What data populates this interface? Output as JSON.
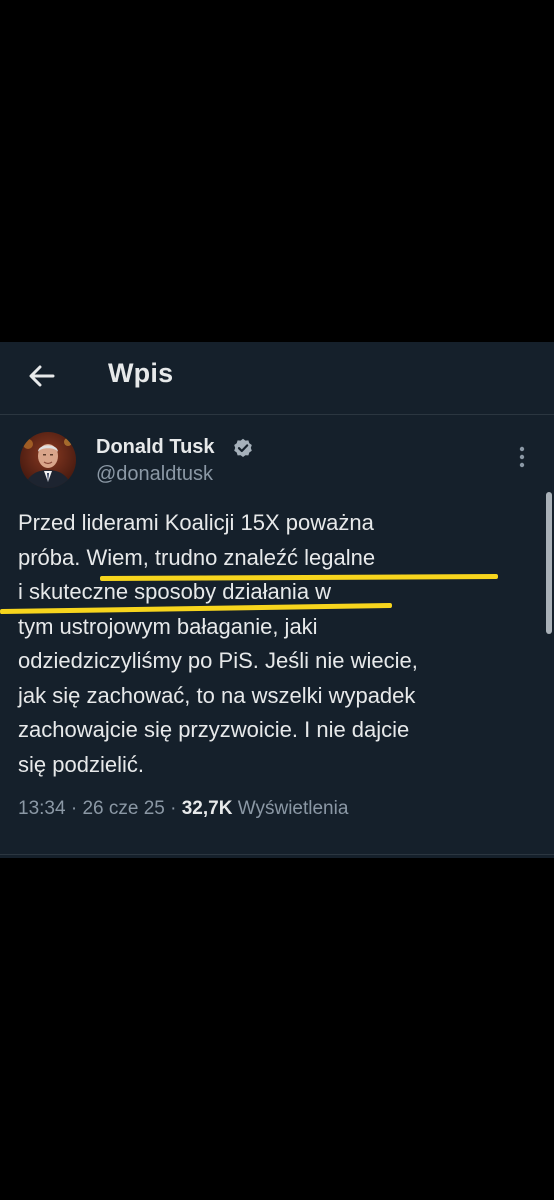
{
  "colors": {
    "background": "#15202b",
    "text_primary": "#e7e9ea",
    "text_secondary": "#8b98a5",
    "highlight": "#f7d51d",
    "verified_badge": "#a5b0ba"
  },
  "header": {
    "back_icon": "arrow-left-icon",
    "title": "Wpis"
  },
  "author": {
    "name": "Donald Tusk",
    "handle": "@donaldtusk",
    "verified_icon": "verified-badge-icon",
    "avatar_icon": "avatar-photo"
  },
  "more_icon": "more-vertical-icon",
  "tweet": {
    "lines": [
      "Przed liderami Koalicji 15X poważna",
      "próba. Wiem, trudno znaleźć legalne",
      "i skuteczne sposoby działania w",
      "tym ustrojowym bałaganie, jaki",
      "odziedziczyliśmy po PiS. Jeśli nie wiecie,",
      "jak się zachować, to na wszelki wypadek",
      "zachowajcie się przyzwoicie. I nie dajcie",
      "się podzielić."
    ]
  },
  "meta": {
    "time": "13:34",
    "separator": " · ",
    "date": "26 cze 25",
    "views_count": "32,7K",
    "views_label": " Wyświetlenia"
  }
}
